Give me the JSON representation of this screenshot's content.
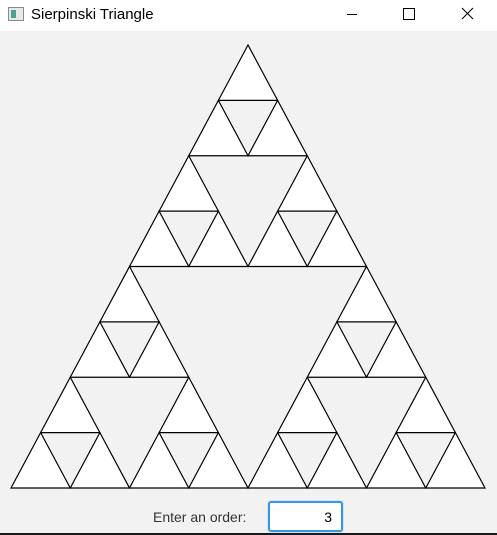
{
  "window": {
    "title": "Sierpinski Triangle",
    "icon": "java-app-icon",
    "controls": [
      "minimize-icon",
      "maximize-icon",
      "close-icon"
    ]
  },
  "sierpinski": {
    "order": 3,
    "stroke_color": "#000000",
    "fill_color": "#ffffff"
  },
  "controls": {
    "order_label": "Enter an order:",
    "order_value": "3"
  },
  "colors": {
    "background": "#f2f2f2",
    "titlebar": "#ffffff",
    "input_focus_border": "#3a96dd"
  }
}
